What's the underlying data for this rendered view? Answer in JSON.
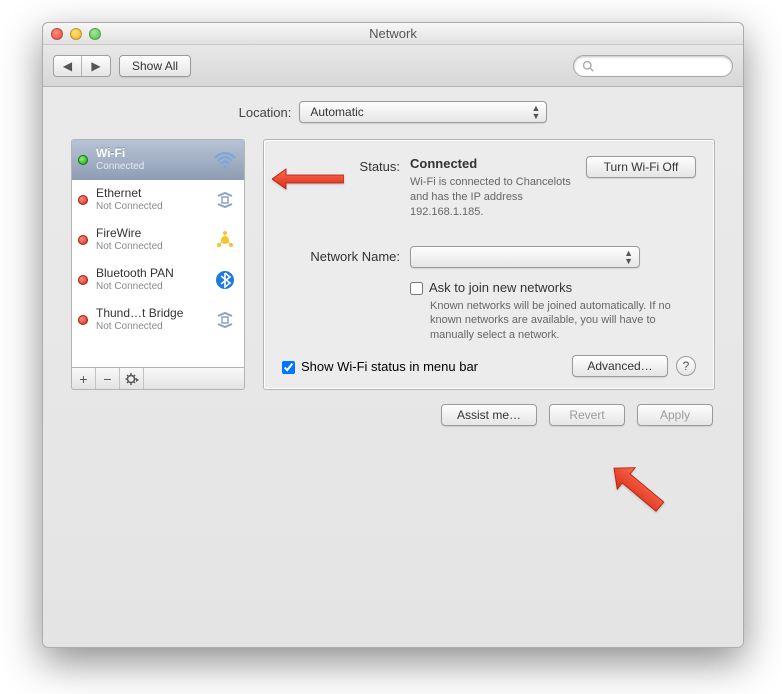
{
  "window": {
    "title": "Network"
  },
  "toolbar": {
    "show_all": "Show All"
  },
  "location": {
    "label": "Location:",
    "value": "Automatic"
  },
  "services": [
    {
      "name": "Wi-Fi",
      "status": "Connected",
      "dot": "green",
      "icon": "wifi",
      "selected": true
    },
    {
      "name": "Ethernet",
      "status": "Not Connected",
      "dot": "red",
      "icon": "ethernet",
      "selected": false
    },
    {
      "name": "FireWire",
      "status": "Not Connected",
      "dot": "red",
      "icon": "firewire",
      "selected": false
    },
    {
      "name": "Bluetooth PAN",
      "status": "Not Connected",
      "dot": "red",
      "icon": "bluetooth",
      "selected": false
    },
    {
      "name": "Thund…t Bridge",
      "status": "Not Connected",
      "dot": "red",
      "icon": "ethernet",
      "selected": false
    }
  ],
  "detail": {
    "status_label": "Status:",
    "status_value": "Connected",
    "turn_off": "Turn Wi-Fi Off",
    "status_desc": "Wi-Fi is connected to Chancelots and has the IP address 192.168.1.185.",
    "network_name_label": "Network Name:",
    "network_name_value": "",
    "ask_join": "Ask to join new networks",
    "ask_join_desc": "Known networks will be joined automatically. If no known networks are available, you will have to manually select a network.",
    "show_menubar": "Show Wi-Fi status in menu bar",
    "advanced": "Advanced…"
  },
  "buttons": {
    "assist": "Assist me…",
    "revert": "Revert",
    "apply": "Apply"
  }
}
